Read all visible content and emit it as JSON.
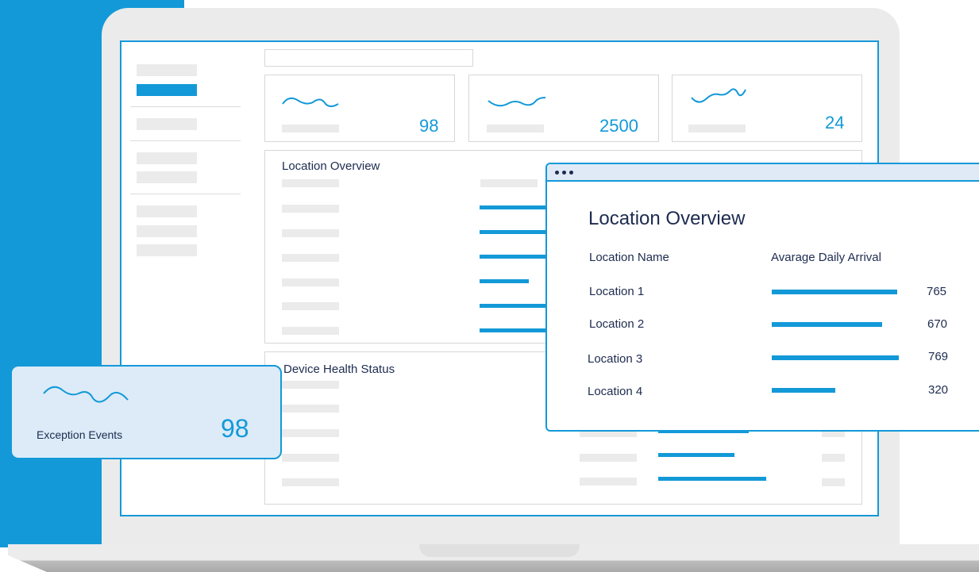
{
  "kpis": [
    {
      "value": "98"
    },
    {
      "value": "2500"
    },
    {
      "value": "24"
    }
  ],
  "panels": {
    "location_overview_title": "Location Overview",
    "device_health_title": "Device Health Status"
  },
  "popup": {
    "title": "Location Overview",
    "col_name": "Location Name",
    "col_value": "Avarage Daily Arrival",
    "rows": [
      {
        "name": "Location 1",
        "value": "765",
        "fraction": 0.99
      },
      {
        "name": "Location 2",
        "value": "670",
        "fraction": 0.87
      },
      {
        "name": "Location 3",
        "value": "769",
        "fraction": 1.0
      },
      {
        "name": "Location 4",
        "value": "320",
        "fraction": 0.5
      }
    ]
  },
  "exception_card": {
    "label": "Exception Events",
    "value": "98"
  },
  "colors": {
    "accent": "#1399d8",
    "text": "#1d2b4f",
    "placeholder": "#ebebeb",
    "card_bg": "#dcebf7"
  }
}
